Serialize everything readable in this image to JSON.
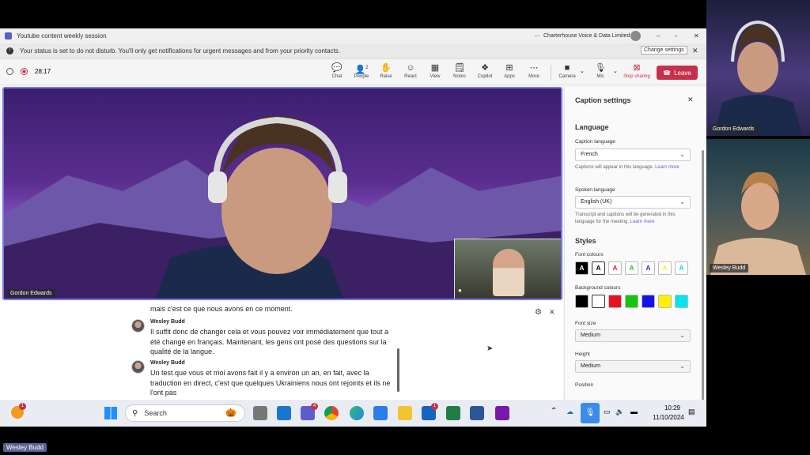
{
  "window": {
    "title": "Youtube content weekly session",
    "org": "Charterhouse Voice & Data Limited"
  },
  "notice": {
    "text": "Your status is set to do not disturb. You'll only get notifications for urgent messages and from your priority contacts.",
    "button": "Change settings"
  },
  "toolbar": {
    "timer": "28:17",
    "items": [
      {
        "label": "Chat",
        "icon": "chat-icon"
      },
      {
        "label": "People",
        "icon": "people-icon",
        "badge": "2"
      },
      {
        "label": "Raise",
        "icon": "hand-icon"
      },
      {
        "label": "React",
        "icon": "smile-icon"
      },
      {
        "label": "View",
        "icon": "view-icon"
      },
      {
        "label": "Notes",
        "icon": "notes-icon"
      },
      {
        "label": "Copilot",
        "icon": "copilot-icon"
      },
      {
        "label": "Apps",
        "icon": "apps-icon"
      },
      {
        "label": "More",
        "icon": "more-icon"
      }
    ],
    "camera": "Camera",
    "mic": "Mic",
    "stop_sharing": "Stop sharing",
    "leave": "Leave"
  },
  "stage": {
    "main_name": "Gordon Edwards"
  },
  "captions": {
    "partial_line": "mais c'est ce que nous avons en ce moment.",
    "entries": [
      {
        "name": "Wesley Budd",
        "text": "Il suffit donc de changer cela et vous pouvez voir immédiatement que tout a été changé en français. Maintenant, les gens ont posé des questions sur la qualité de la langue."
      },
      {
        "name": "Wesley Budd",
        "text": "Un test que vous et moi avons fait il y a environ un an, en fait, avec la traduction en direct, c'est que quelques Ukrainiens nous ont rejoints et ils ne l'ont pas"
      }
    ]
  },
  "panel": {
    "title": "Caption settings",
    "language_heading": "Language",
    "caption_language_label": "Caption language",
    "caption_language": "French",
    "caption_help": "Captions will appear in this language.",
    "caption_learn": "Learn more",
    "spoken_language_label": "Spoken language",
    "spoken_language": "English (UK)",
    "spoken_help": "Transcript and captions will be generated in this language for the meeting.",
    "spoken_learn": "Learn more",
    "styles_heading": "Styles",
    "font_colours_label": "Font colours",
    "font_colours": [
      "#000000",
      "#ffffff",
      "#e81123",
      "#16c60c",
      "#2b2bd6",
      "#fff100",
      "#00d7e0"
    ],
    "bg_colours_label": "Background colours",
    "bg_colours": [
      "#000000",
      "#ffffff",
      "#e81123",
      "#16c60c",
      "#1414e8",
      "#fff100",
      "#00e5ee"
    ],
    "font_size_label": "Font size",
    "font_size": "Medium",
    "height_label": "Height",
    "height": "Medium",
    "position_label": "Position"
  },
  "taskbar": {
    "search": "Search",
    "time": "10:29",
    "date": "11/10/2024",
    "teams_badge": "4",
    "word_badge": "1",
    "weather_badge": "1"
  },
  "side": {
    "top_name": "Gordon Edwards",
    "bottom_name": "Wesley Budd"
  },
  "footer_name": "Wesley Budd"
}
